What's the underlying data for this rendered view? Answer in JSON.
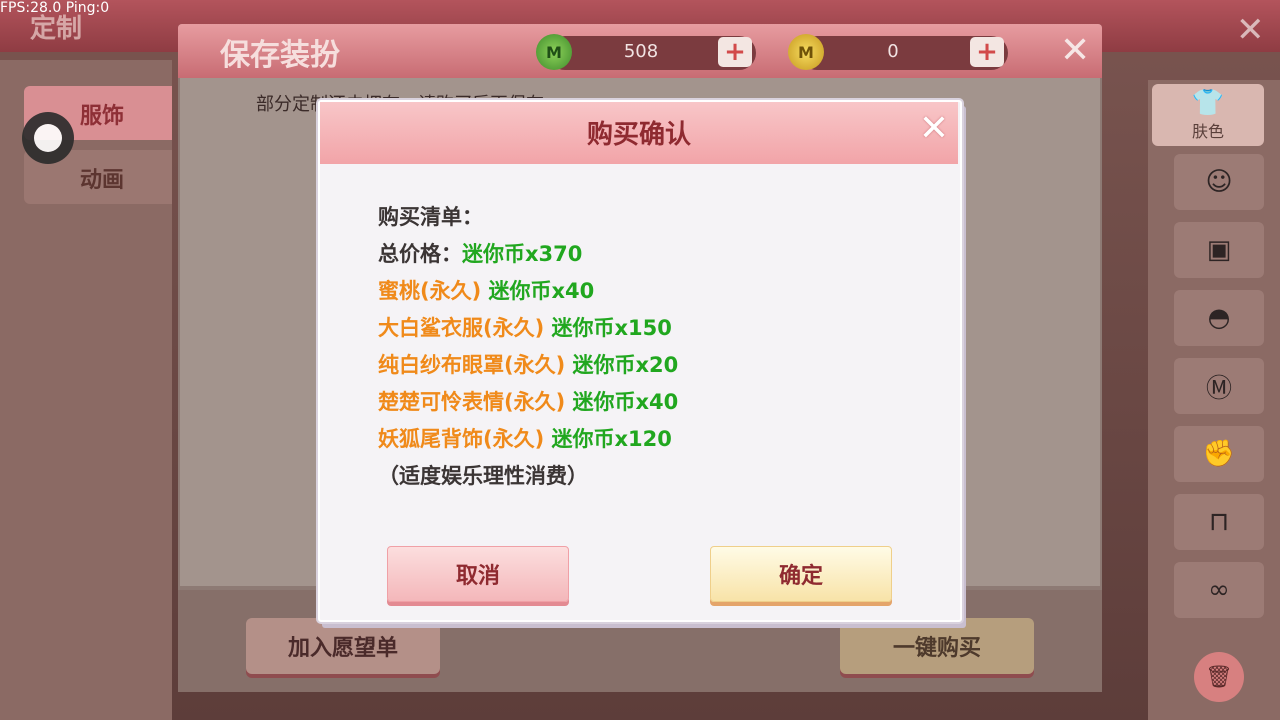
{
  "hud": {
    "fps_text": "FPS:28.0  Ping:0"
  },
  "background": {
    "title": "定制",
    "left_tabs": [
      "服饰",
      "动画"
    ],
    "right_categories": {
      "skin_label": "肤色"
    }
  },
  "save_panel": {
    "title": "保存装扮",
    "notice": "部分定制还未拥有，请购买后再保存",
    "mini_coin_icon": "M",
    "mini_coin_value": "508",
    "gold_coin_icon": "M",
    "gold_coin_value": "0",
    "plus_label": "+",
    "close_label": "✕",
    "wishlist_label": "加入愿望单",
    "buy_all_label": "一键购买"
  },
  "dialog": {
    "title": "购买确认",
    "close_label": "✕",
    "list_label": "购买清单：",
    "total_label": "总价格：",
    "total_price": "迷你币x370",
    "items": [
      {
        "name": "蜜桃(永久)",
        "price": "迷你币x40"
      },
      {
        "name": "大白鲨衣服(永久)",
        "price": "迷你币x150"
      },
      {
        "name": "纯白纱布眼罩(永久)",
        "price": "迷你币x20"
      },
      {
        "name": "楚楚可怜表情(永久)",
        "price": "迷你币x40"
      },
      {
        "name": "妖狐尾背饰(永久)",
        "price": "迷你币x120"
      }
    ],
    "note": "（适度娱乐理性消费）",
    "cancel_label": "取消",
    "confirm_label": "确定"
  },
  "colors": {
    "accent": "#f2a4a8",
    "item_name": "#f08a1a",
    "price": "#21a71f",
    "title": "#8f2a30"
  }
}
